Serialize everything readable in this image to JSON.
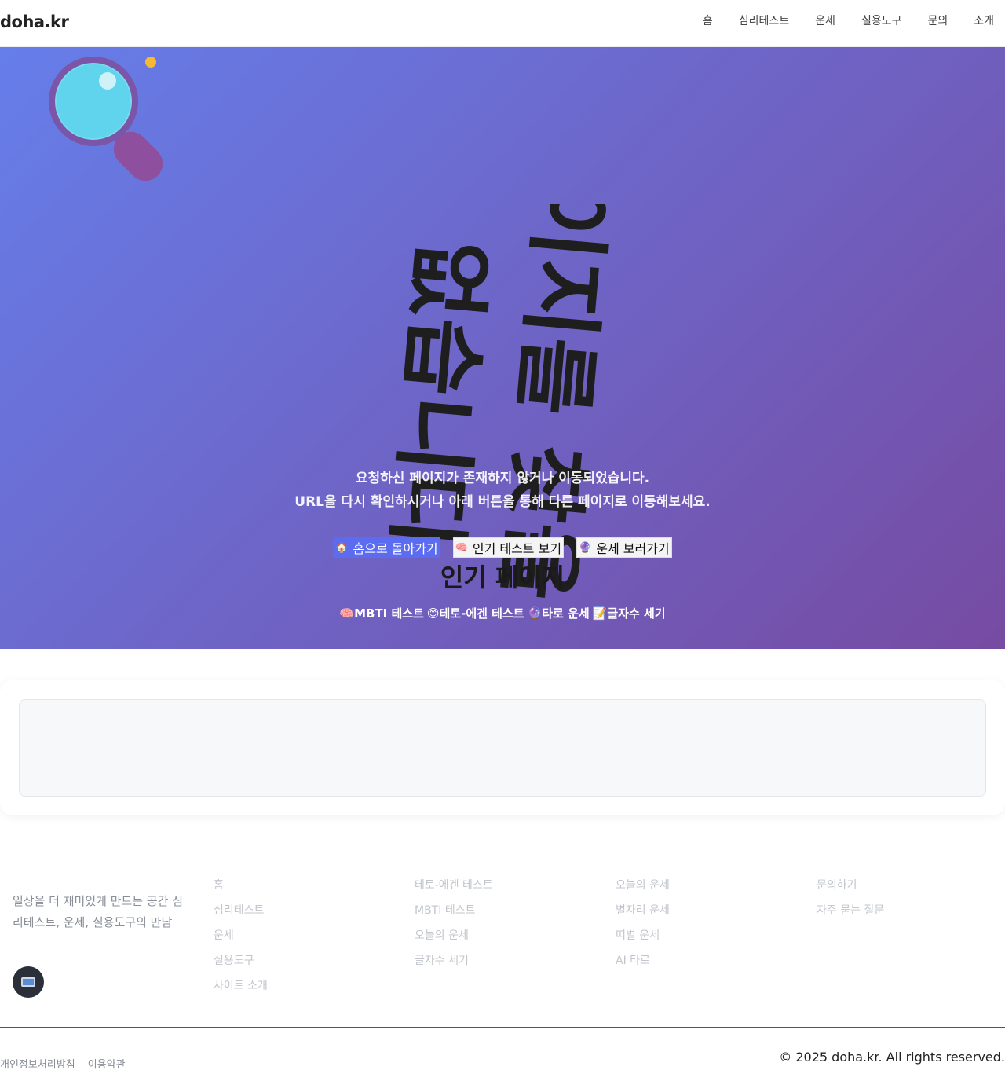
{
  "header": {
    "logo": "doha.kr",
    "nav": [
      "홈",
      "심리테스트",
      "운세",
      "실용도구",
      "문의",
      "소개"
    ]
  },
  "hero": {
    "rotated_title": "페이지를 찾을 수\n없습니다",
    "description_line1": "요청하신 페이지가 존재하지 않거나 이동되었습니다.",
    "description_line2": "URL을 다시 확인하시거나 아래 버튼을 통해 다른 페이지로 이동해보세요.",
    "buttons": [
      {
        "icon": "🏠",
        "label": "홈으로 돌아가기"
      },
      {
        "icon": "🧠",
        "label": "인기 테스트 보기"
      },
      {
        "icon": "🔮",
        "label": "운세 보러가기"
      }
    ],
    "popular_title": "인기 페이지",
    "popular_links": [
      {
        "icon": "🧠",
        "label": "MBTI 테스트"
      },
      {
        "icon": "😊",
        "label": "테토-에겐 테스트"
      },
      {
        "icon": "🔮",
        "label": "타로 운세"
      },
      {
        "icon": "📝",
        "label": "글자수 세기"
      }
    ]
  },
  "footer": {
    "tagline": "일상을 더 재미있게 만드는 공간 심리테스트, 운세, 실용도구의 만남",
    "col1": [
      "홈",
      "심리테스트",
      "운세",
      "실용도구",
      "사이트 소개"
    ],
    "col2": [
      "테토-에겐 테스트",
      "MBTI 테스트",
      "오늘의 운세",
      "글자수 세기"
    ],
    "col3": [
      "오늘의 운세",
      "별자리 운세",
      "띠별 운세",
      "AI 타로"
    ],
    "col4": [
      "문의하기",
      "자주 묻는 질문"
    ],
    "legal": [
      "개인정보처리방침",
      "이용약관"
    ],
    "copyright": "© 2025 doha.kr. All rights reserved."
  },
  "colors": {
    "hero_start": "#667eea",
    "hero_end": "#764ba2",
    "primary_button": "#5b6cf0"
  }
}
